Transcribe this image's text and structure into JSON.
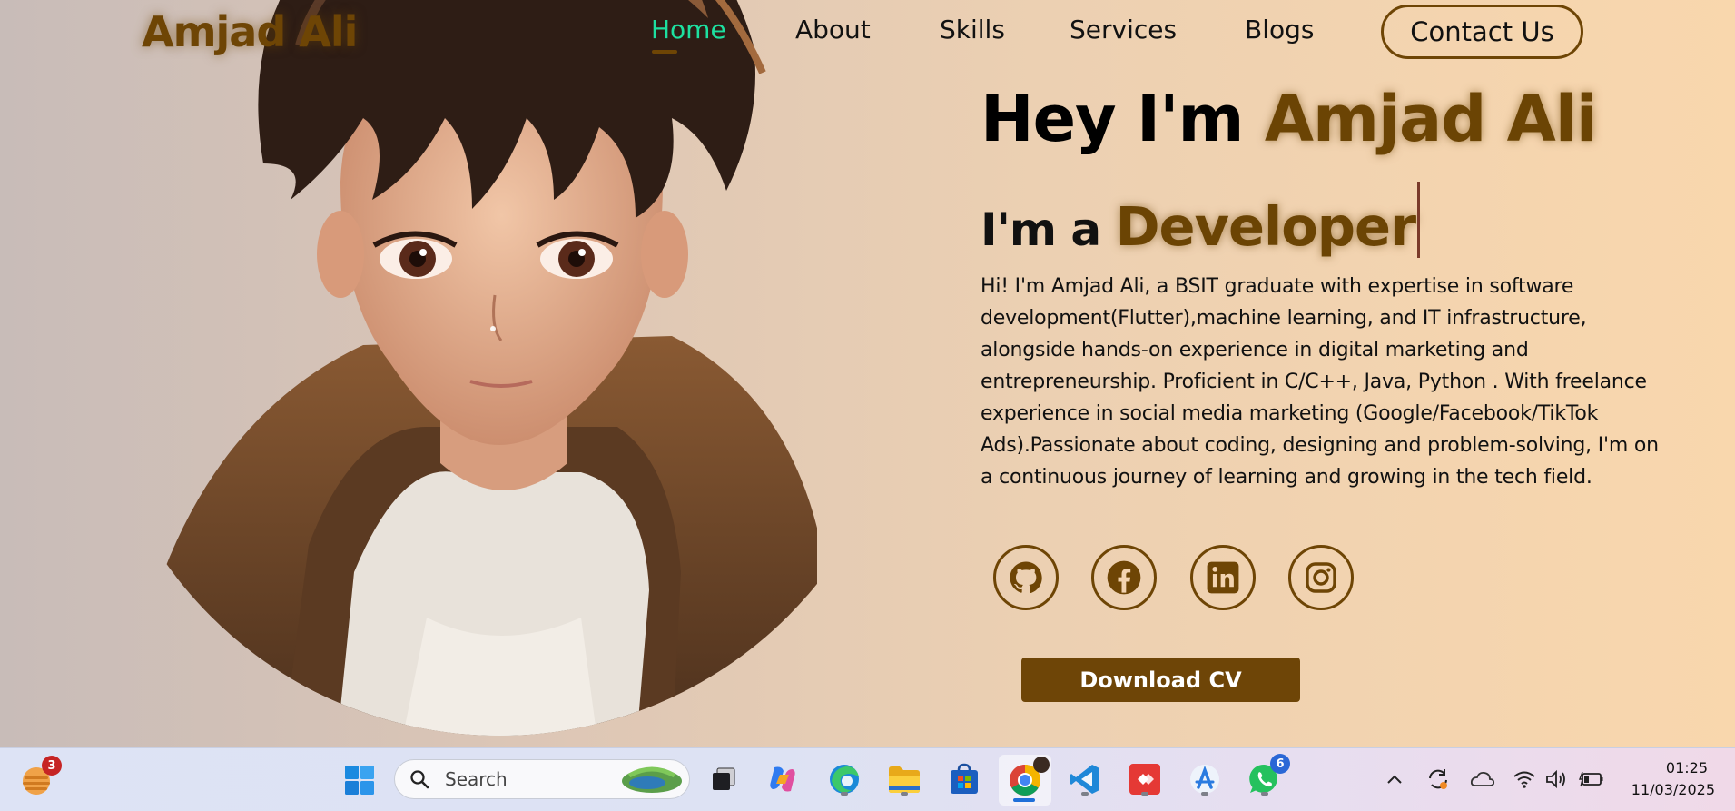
{
  "site": {
    "brand": "Amjad Ali",
    "nav": [
      "Home",
      "About",
      "Skills",
      "Services",
      "Blogs"
    ],
    "contact_label": "Contact Us"
  },
  "hero": {
    "greeting": "Hey I'm ",
    "name": "Amjad Ali",
    "prefix": "I'm a ",
    "role": "Developer",
    "bio": "Hi! I'm Amjad Ali, a BSIT graduate with expertise in software development(Flutter),machine learning, and IT infrastructure, alongside hands-on experience in digital marketing and entrepreneurship. Proficient in C/C++, Java, Python . With freelance experience in social media marketing (Google/Facebook/TikTok Ads).Passionate about coding, designing and problem-solving, I'm on a continuous journey of learning and growing in the tech field.",
    "socials": [
      "github-icon",
      "facebook-icon",
      "linkedin-icon",
      "instagram-icon"
    ],
    "download_label": "Download CV"
  },
  "taskbar": {
    "widget_badge": "3",
    "search_placeholder": "Search",
    "whatsapp_badge": "6",
    "time": "01:25",
    "date": "11/03/2025"
  },
  "colors": {
    "accent": "#6e4505",
    "active_nav": "#1de0a0",
    "button_bg": "#6e4507"
  }
}
